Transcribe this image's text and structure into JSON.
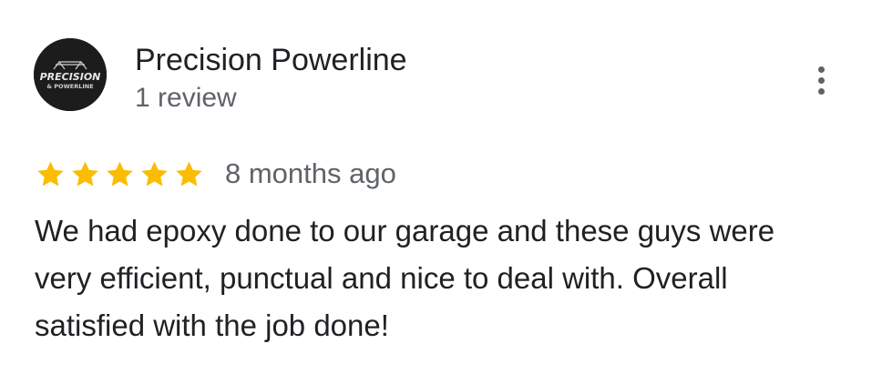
{
  "review": {
    "reviewer": {
      "name": "Precision Powerline",
      "review_count": "1 review",
      "avatar": {
        "logo_text_top": "PRECISION",
        "logo_text_bottom": "& POWERLINE",
        "background": "#1c1c1c"
      }
    },
    "rating": {
      "stars": 5,
      "max": 5,
      "star_color": "#fbbc04"
    },
    "date": "8 months ago",
    "text": "We had epoxy done to our garage and these guys were very efficient, punctual and nice to deal with. Overall satisfied with the job done!",
    "menu_icon": "more-vert-icon"
  }
}
